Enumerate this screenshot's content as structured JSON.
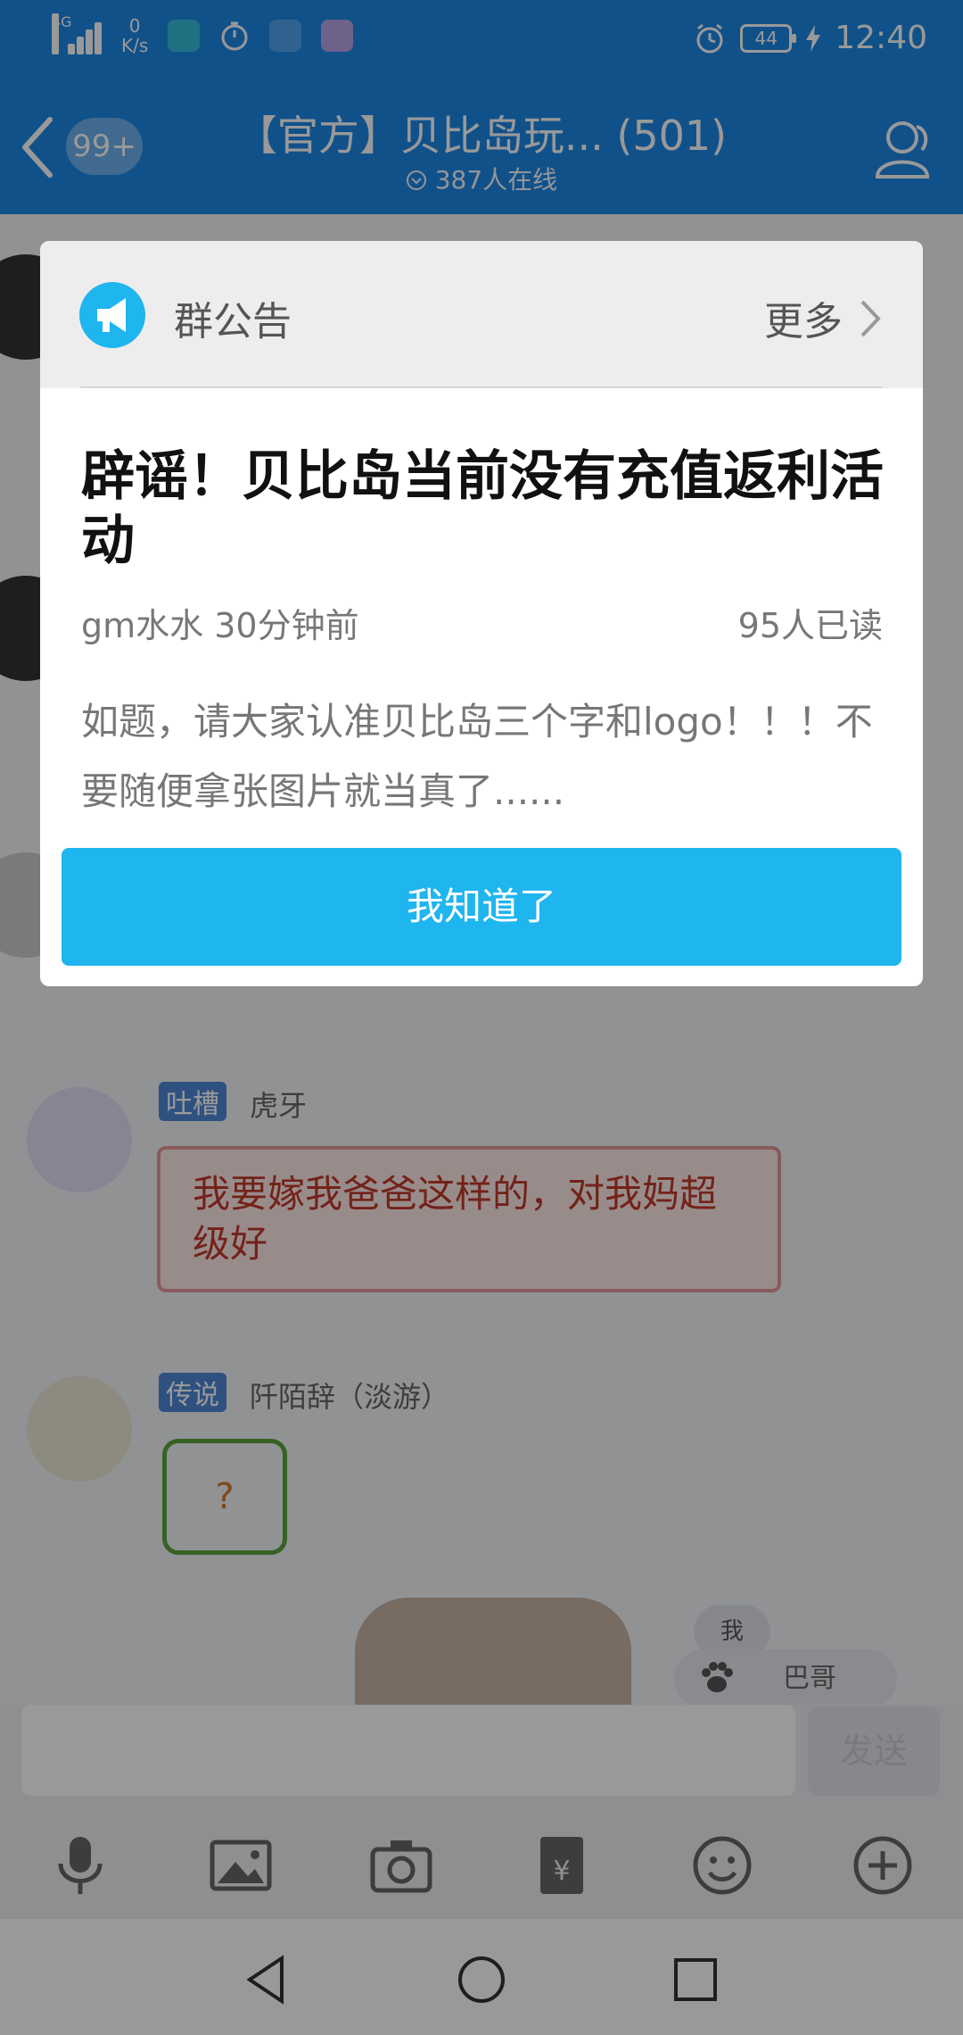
{
  "status_bar": {
    "network": "4G",
    "speed_value": "0",
    "speed_unit": "K/s",
    "battery": "44",
    "time": "12:40"
  },
  "header": {
    "unread_badge": "99+",
    "title": "【官方】贝比岛玩... (501)",
    "online": "387人在线"
  },
  "chat": {
    "messages": [
      {
        "tag": "吐槽",
        "sender": "虎牙",
        "text": "我要嫁我爸爸这样的，对我妈超级好"
      },
      {
        "tag": "传说",
        "sender": "阡陌辞（淡游）",
        "sticker": "?"
      }
    ],
    "me_badge": "我",
    "pet_name": "巴哥"
  },
  "input": {
    "placeholder": "",
    "send_label": "发送"
  },
  "dialog": {
    "header": "群公告",
    "more": "更多",
    "headline": "辟谣！贝比岛当前没有充值返利活动",
    "author_time": "gm水水 30分钟前",
    "read_count": "95人已读",
    "body": "如题，请大家认准贝比岛三个字和logo！！！不要随便拿张图片就当真了......",
    "confirm": "我知道了"
  },
  "colors": {
    "header_blue": "#1d88e6",
    "accent_blue": "#1fb5ef"
  }
}
